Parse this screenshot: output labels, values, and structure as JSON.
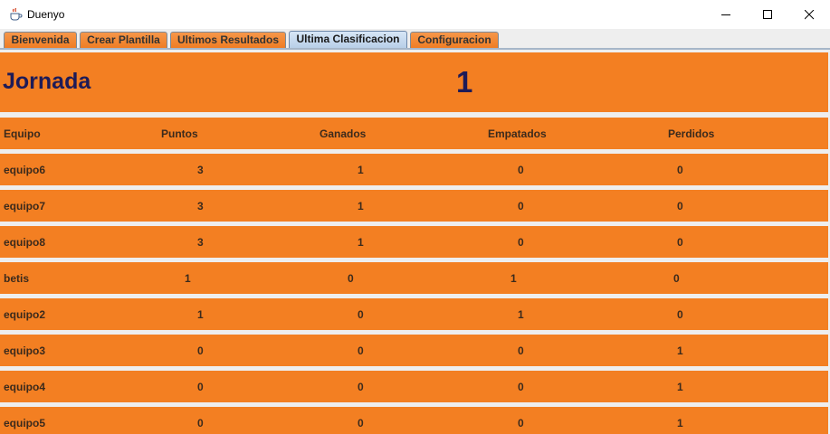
{
  "window": {
    "title": "Duenyo",
    "app_icon": "java-cup-icon",
    "controls": [
      "minimize-icon",
      "maximize-icon",
      "close-icon"
    ]
  },
  "tabs": [
    {
      "label": "Bienvenida",
      "active": false
    },
    {
      "label": "Crear Plantilla",
      "active": false
    },
    {
      "label": "Ultimos Resultados",
      "active": false
    },
    {
      "label": "Ultima Clasificacion",
      "active": true
    },
    {
      "label": "Configuracion",
      "active": false
    }
  ],
  "colors": {
    "panel_orange": "#f37f22",
    "heading_navy": "#1e1b57",
    "active_tab": "#b8cfe8"
  },
  "standings": {
    "jornada_label": "Jornada",
    "jornada_number": "1",
    "columns": [
      "Equipo",
      "Puntos",
      "Ganados",
      "Empatados",
      "Perdidos"
    ],
    "rows": [
      [
        "equipo6",
        "3",
        "1",
        "0",
        "0"
      ],
      [
        "equipo7",
        "3",
        "1",
        "0",
        "0"
      ],
      [
        "equipo8",
        "3",
        "1",
        "0",
        "0"
      ],
      [
        "betis",
        "1",
        "0",
        "1",
        "0"
      ],
      [
        "equipo2",
        "1",
        "0",
        "1",
        "0"
      ],
      [
        "equipo3",
        "0",
        "0",
        "0",
        "1"
      ],
      [
        "equipo4",
        "0",
        "0",
        "0",
        "1"
      ],
      [
        "equipo5",
        "0",
        "0",
        "0",
        "1"
      ]
    ]
  }
}
